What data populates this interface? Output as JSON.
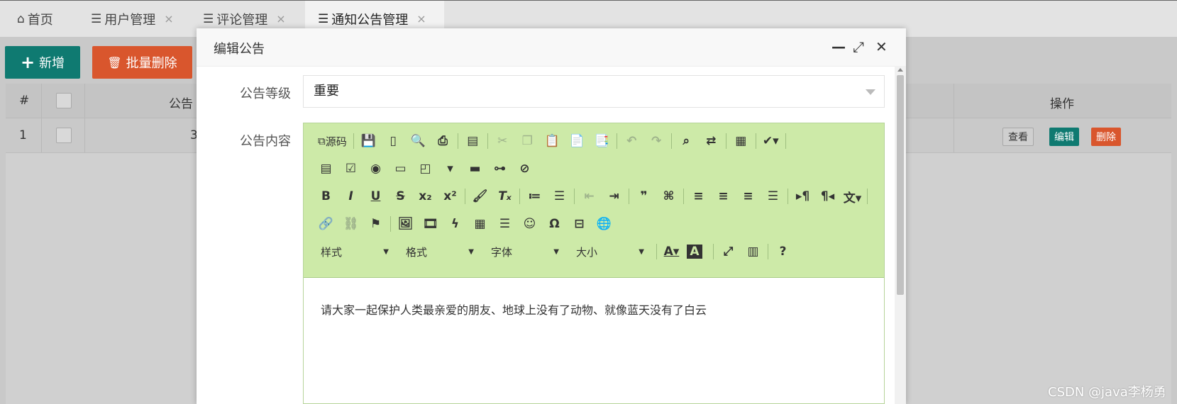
{
  "tabs": [
    {
      "icon": "home-icon",
      "glyph": "⌂",
      "label": "首页",
      "closable": false
    },
    {
      "icon": "list-icon",
      "glyph": "☰",
      "label": "用户管理",
      "closable": true
    },
    {
      "icon": "list-icon",
      "glyph": "☰",
      "label": "评论管理",
      "closable": true
    },
    {
      "icon": "list-icon",
      "glyph": "☰",
      "label": "通知公告管理",
      "closable": true,
      "active": true
    }
  ],
  "close_glyph": "×",
  "toolbar": {
    "add_label": "新增",
    "batch_delete_label": "批量删除"
  },
  "table": {
    "headers": {
      "index": "#",
      "col_title_partial": "公告",
      "actions": "操作"
    },
    "rows": [
      {
        "index": "1",
        "cell_partial": "3"
      }
    ],
    "row_actions": {
      "view": "查看",
      "edit": "编辑",
      "delete": "删除"
    }
  },
  "modal": {
    "title": "编辑公告",
    "controls": {
      "minimize": "—",
      "maximize": "⤢",
      "close": "✕"
    },
    "level_label": "公告等级",
    "level_value": "重要",
    "content_label": "公告内容",
    "editor": {
      "source_label": "源码",
      "combos": [
        "样式",
        "格式",
        "字体",
        "大小"
      ],
      "content": "请大家一起保护人类最亲爱的朋友、地球上没有了动物、就像蓝天没有了白云"
    }
  },
  "watermark": "CSDN @java李杨勇",
  "colors": {
    "primary": "#0f7a71",
    "danger": "#d9562d",
    "editor_toolbar": "#cdeaa8"
  }
}
